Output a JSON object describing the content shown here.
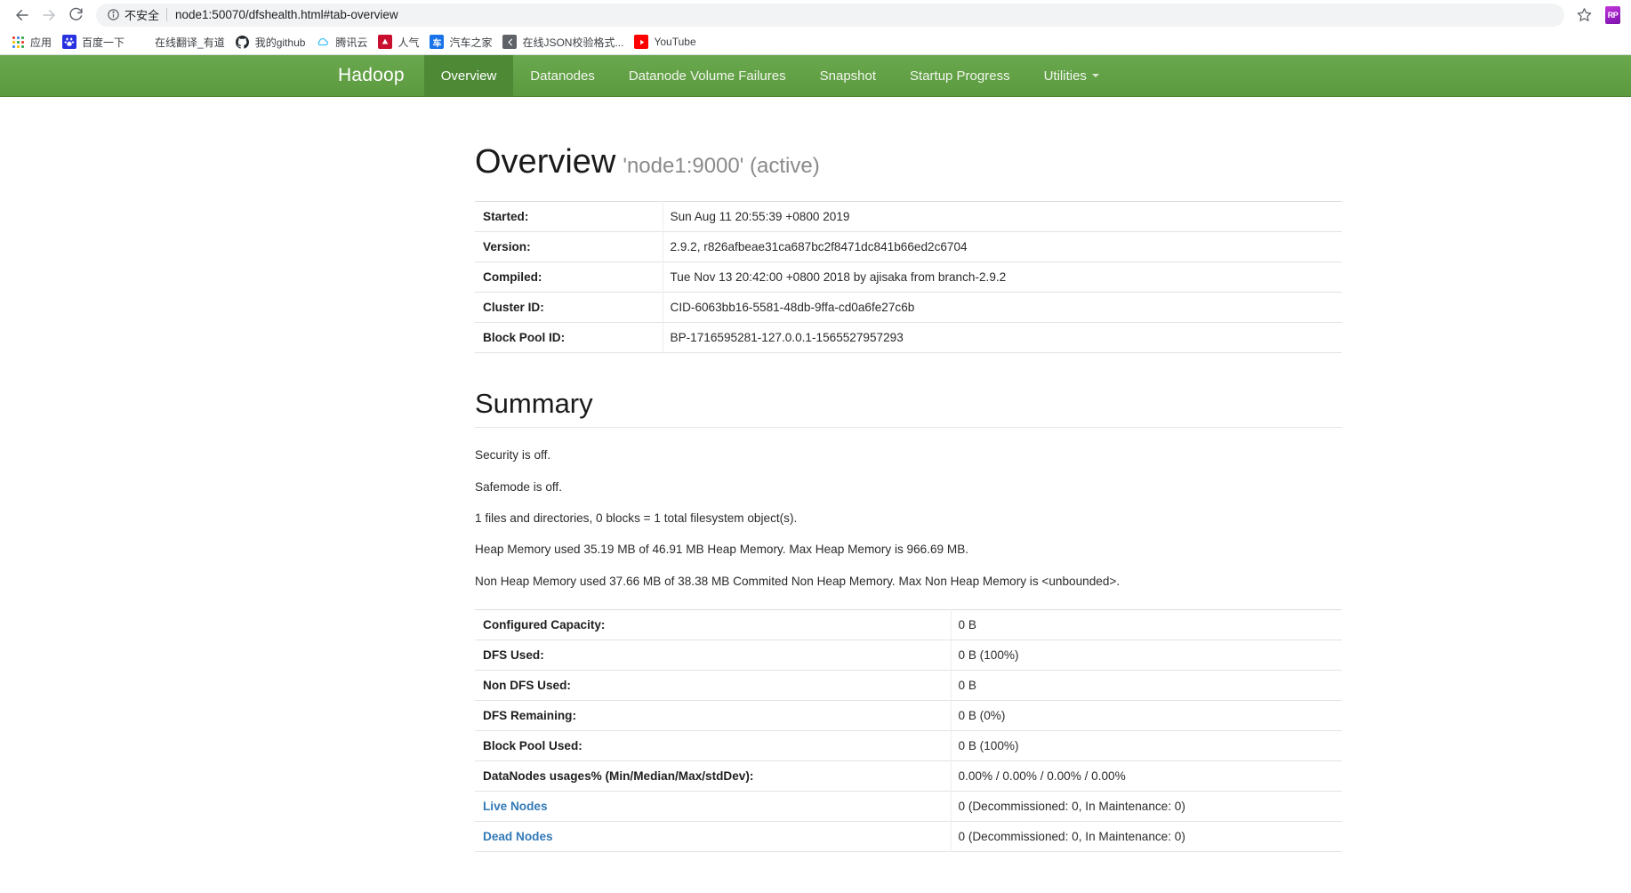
{
  "browser": {
    "back_icon": "back-arrow-icon",
    "forward_icon": "forward-arrow-icon",
    "reload_icon": "reload-icon",
    "security_label": "不安全",
    "url": "node1:50070/dfshealth.html#tab-overview",
    "star_icon": "star-icon",
    "extension_label": "RP",
    "bookmarks": [
      {
        "label": "应用",
        "icon": "apps-grid-icon"
      },
      {
        "label": "百度一下",
        "icon": "baidu-icon"
      },
      {
        "label": "在线翻译_有道",
        "icon": "youdao-icon"
      },
      {
        "label": "我的github",
        "icon": "github-icon"
      },
      {
        "label": "腾讯云",
        "icon": "tencent-cloud-icon"
      },
      {
        "label": "人气",
        "icon": "renqi-icon"
      },
      {
        "label": "汽车之家",
        "icon": "autohome-icon"
      },
      {
        "label": "在线JSON校验格式...",
        "icon": "json-format-icon"
      },
      {
        "label": "YouTube",
        "icon": "youtube-icon"
      }
    ]
  },
  "navbar": {
    "brand": "Hadoop",
    "items": [
      {
        "label": "Overview",
        "active": true
      },
      {
        "label": "Datanodes",
        "active": false
      },
      {
        "label": "Datanode Volume Failures",
        "active": false
      },
      {
        "label": "Snapshot",
        "active": false
      },
      {
        "label": "Startup Progress",
        "active": false
      },
      {
        "label": "Utilities",
        "active": false,
        "has_caret": true
      }
    ],
    "accent_color": "#5fa33f",
    "active_color": "#4e8a36"
  },
  "overview": {
    "title": "Overview",
    "subtitle": "'node1:9000' (active)",
    "rows": [
      {
        "label": "Started:",
        "value": "Sun Aug 11 20:55:39 +0800 2019"
      },
      {
        "label": "Version:",
        "value": "2.9.2, r826afbeae31ca687bc2f8471dc841b66ed2c6704"
      },
      {
        "label": "Compiled:",
        "value": "Tue Nov 13 20:42:00 +0800 2018 by ajisaka from branch-2.9.2"
      },
      {
        "label": "Cluster ID:",
        "value": "CID-6063bb16-5581-48db-9ffa-cd0a6fe27c6b"
      },
      {
        "label": "Block Pool ID:",
        "value": "BP-1716595281-127.0.0.1-1565527957293"
      }
    ]
  },
  "summary": {
    "title": "Summary",
    "notes": [
      "Security is off.",
      "Safemode is off.",
      "1 files and directories, 0 blocks = 1 total filesystem object(s).",
      "Heap Memory used 35.19 MB of 46.91 MB Heap Memory. Max Heap Memory is 966.69 MB.",
      "Non Heap Memory used 37.66 MB of 38.38 MB Commited Non Heap Memory. Max Non Heap Memory is <unbounded>."
    ],
    "rows": [
      {
        "label": "Configured Capacity:",
        "value": "0 B",
        "link": false
      },
      {
        "label": "DFS Used:",
        "value": "0 B (100%)",
        "link": false
      },
      {
        "label": "Non DFS Used:",
        "value": "0 B",
        "link": false
      },
      {
        "label": "DFS Remaining:",
        "value": "0 B (0%)",
        "link": false
      },
      {
        "label": "Block Pool Used:",
        "value": "0 B (100%)",
        "link": false
      },
      {
        "label": "DataNodes usages% (Min/Median/Max/stdDev):",
        "value": "0.00% / 0.00% / 0.00% / 0.00%",
        "link": false
      },
      {
        "label": "Live Nodes",
        "value": "0 (Decommissioned: 0, In Maintenance: 0)",
        "link": true
      },
      {
        "label": "Dead Nodes",
        "value": "0 (Decommissioned: 0, In Maintenance: 0)",
        "link": true
      }
    ]
  }
}
